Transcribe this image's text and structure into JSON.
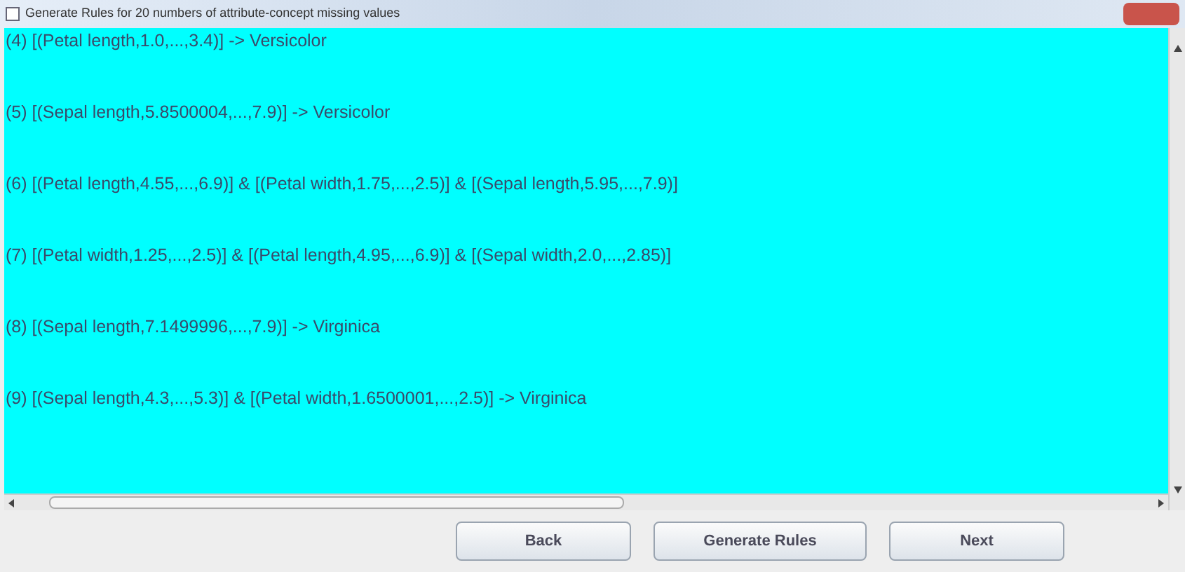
{
  "window": {
    "title": "Generate Rules for 20 numbers of attribute-concept missing values"
  },
  "rules": [
    "(4) [(Petal length,1.0,...,3.4)] -> Versicolor",
    "(5) [(Sepal length,5.8500004,...,7.9)] -> Versicolor",
    "(6) [(Petal length,4.55,...,6.9)] & [(Petal  width,1.75,...,2.5)] & [(Sepal length,5.95,...,7.9)]",
    "(7) [(Petal  width,1.25,...,2.5)] & [(Petal length,4.95,...,6.9)] & [(Sepal  width,2.0,...,2.85)]",
    "(8) [(Sepal length,7.1499996,...,7.9)] -> Virginica",
    "(9) [(Sepal length,4.3,...,5.3)] & [(Petal  width,1.6500001,...,2.5)] -> Virginica"
  ],
  "buttons": [
    "Back",
    "Generate Rules",
    "Next"
  ]
}
